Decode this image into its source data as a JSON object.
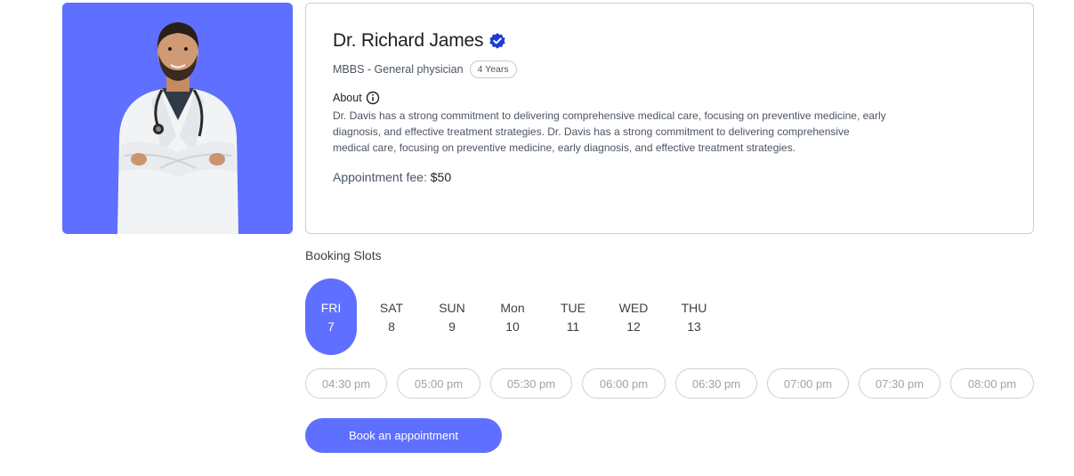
{
  "doctor": {
    "name": "Dr. Richard James",
    "degree": "MBBS - General physician",
    "experience": "4 Years",
    "about_label": "About",
    "about_text": "Dr. Davis has a strong commitment to delivering comprehensive medical care, focusing on preventive medicine, early diagnosis, and effective treatment strategies. Dr. Davis has a strong commitment to delivering comprehensive medical care, focusing on preventive medicine, early diagnosis, and effective treatment strategies.",
    "fee_label": "Appointment fee:",
    "fee_value": "$50",
    "photo_bg": "#5f6fff",
    "verified_icon": "verified-badge-icon",
    "info_icon": "info-circle-icon"
  },
  "booking": {
    "title": "Booking Slots",
    "days": [
      {
        "name": "FRI",
        "num": "7",
        "selected": true
      },
      {
        "name": "SAT",
        "num": "8",
        "selected": false
      },
      {
        "name": "SUN",
        "num": "9",
        "selected": false
      },
      {
        "name": "Mon",
        "num": "10",
        "selected": false
      },
      {
        "name": "TUE",
        "num": "11",
        "selected": false
      },
      {
        "name": "WED",
        "num": "12",
        "selected": false
      },
      {
        "name": "THU",
        "num": "13",
        "selected": false
      }
    ],
    "times": [
      "04:30 pm",
      "05:00 pm",
      "05:30 pm",
      "06:00 pm",
      "06:30 pm",
      "07:00 pm",
      "07:30 pm",
      "08:00 pm"
    ],
    "book_label": "Book an appointment",
    "accent": "#5f6fff"
  }
}
